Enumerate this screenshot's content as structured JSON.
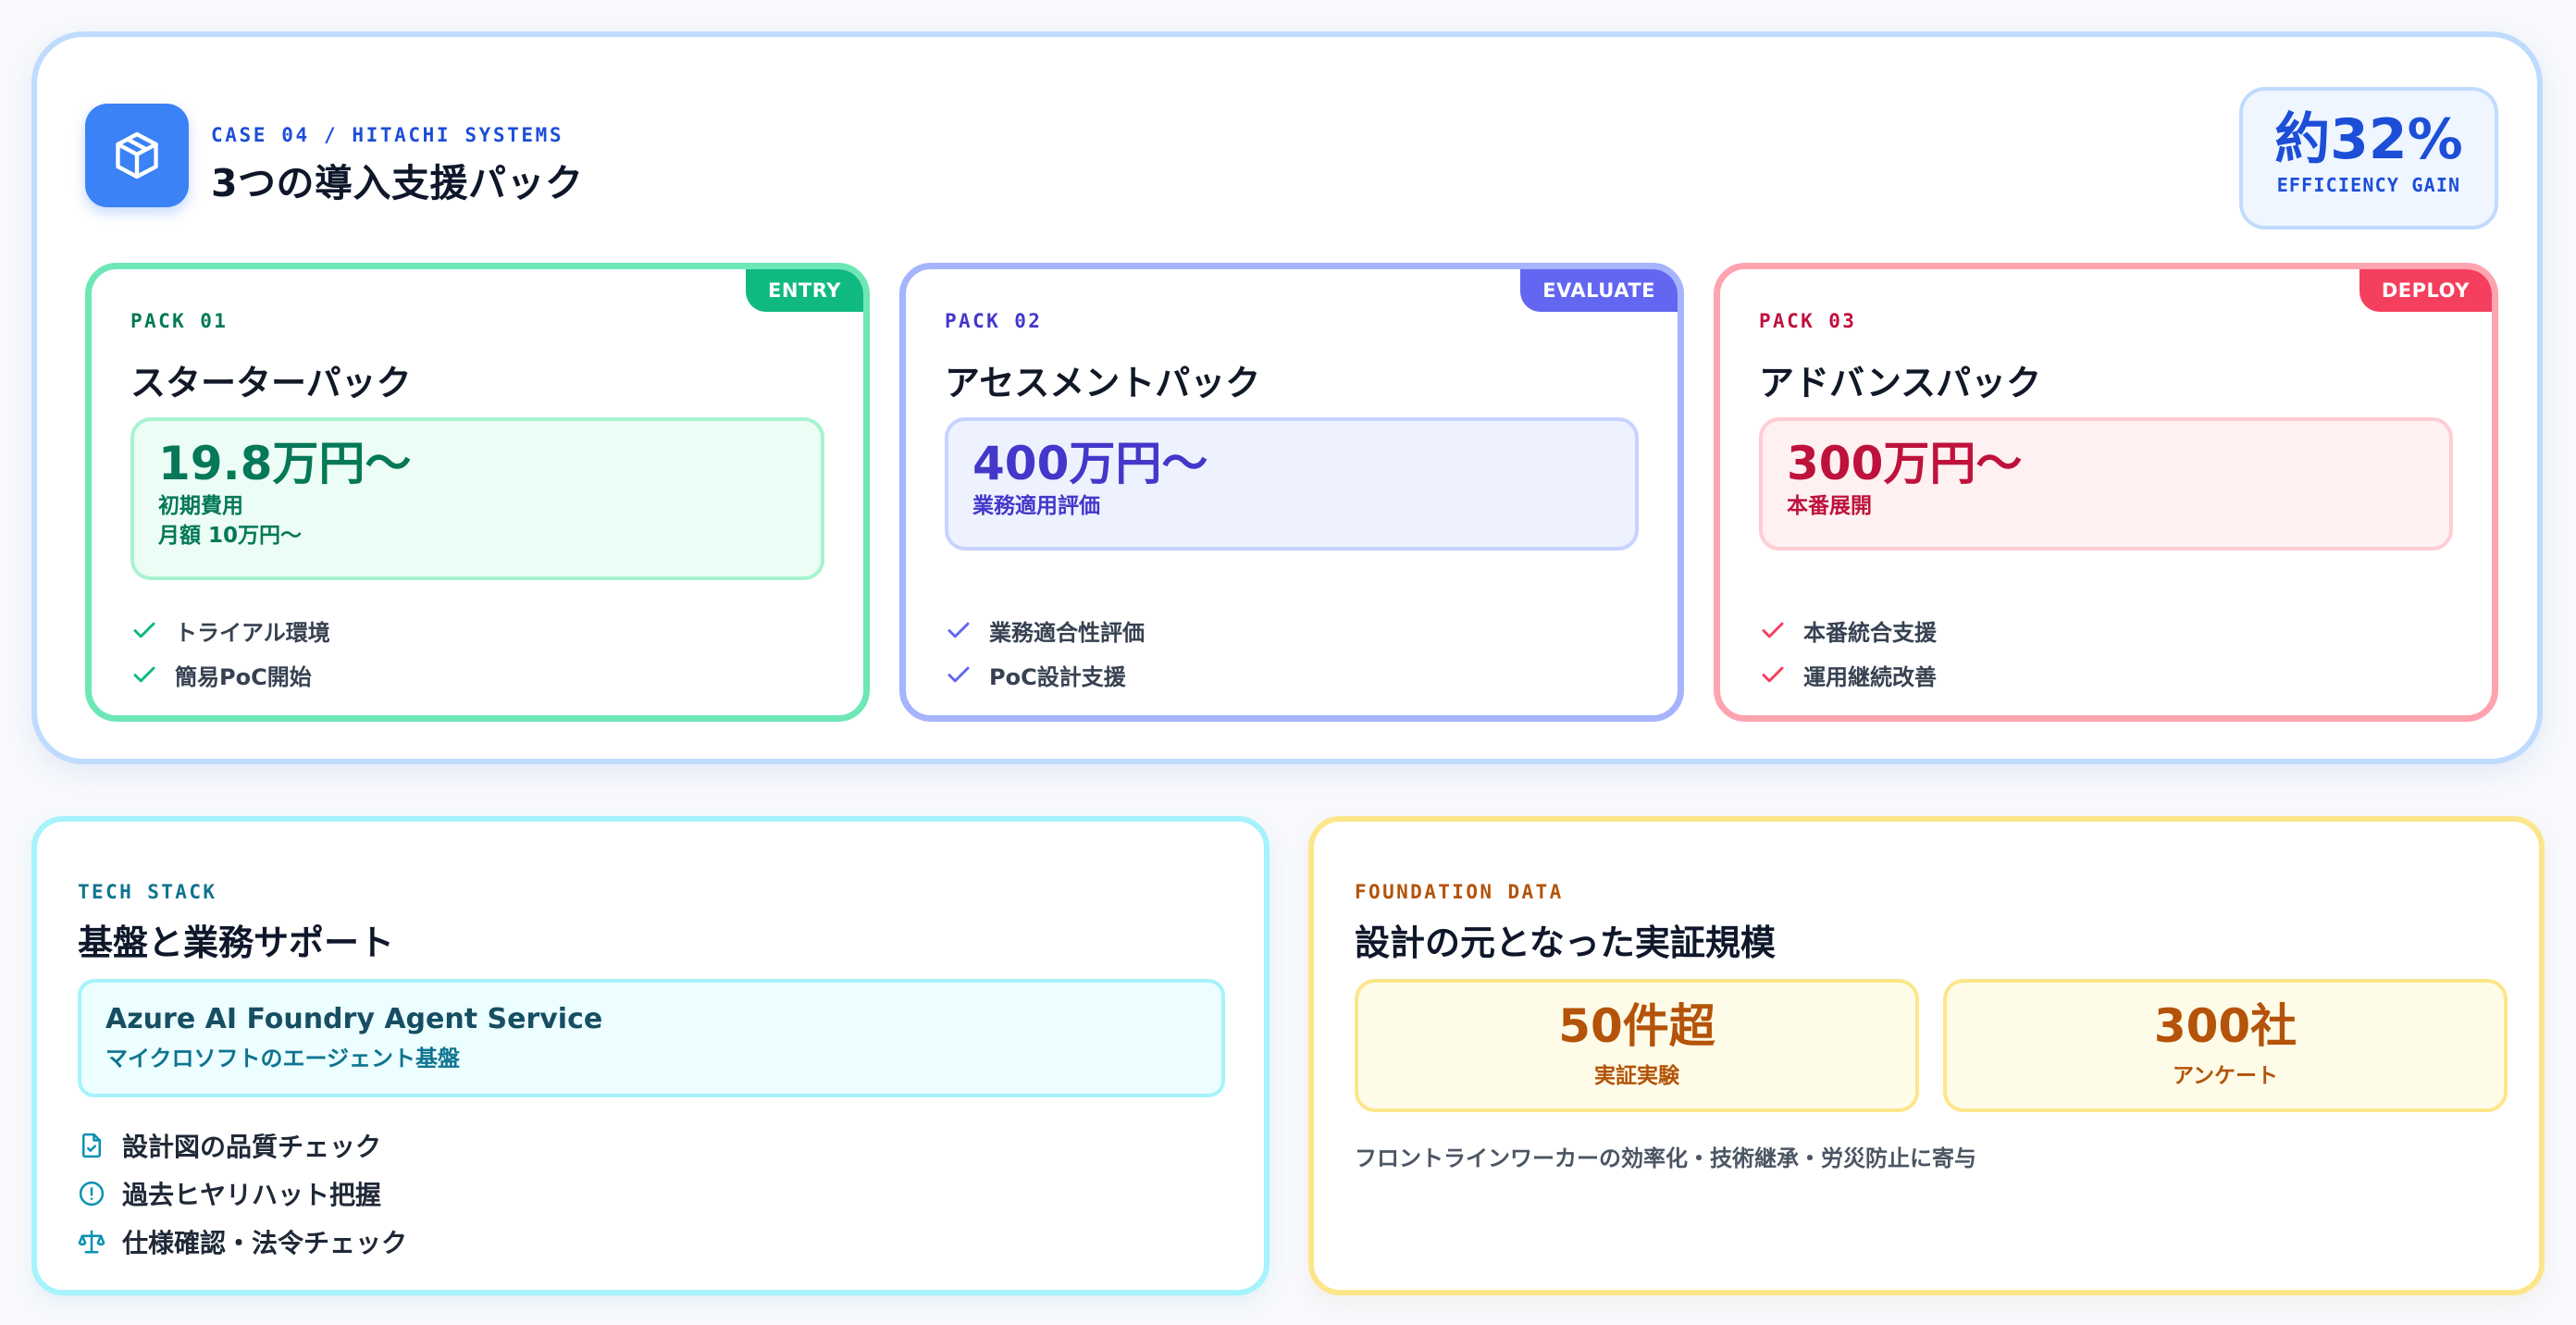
{
  "case": {
    "eyebrow": "CASE 04 / HITACHI SYSTEMS",
    "title": "3つの導入支援パック",
    "icon": "package-icon",
    "gain_value": "約32%",
    "gain_label": "EFFICIENCY GAIN"
  },
  "packs": [
    {
      "badge": "ENTRY",
      "eyebrow": "PACK 01",
      "name": "スターターパック",
      "price": "19.8万円〜",
      "price_sub": [
        "初期費用",
        "月額 10万円〜"
      ],
      "features": [
        "トライアル環境",
        "簡易PoC開始"
      ],
      "color": "#10b981"
    },
    {
      "badge": "EVALUATE",
      "eyebrow": "PACK 02",
      "name": "アセスメントパック",
      "price": "400万円〜",
      "price_sub": [
        "業務適用評価"
      ],
      "features": [
        "業務適合性評価",
        "PoC設計支援"
      ],
      "color": "#6366f1"
    },
    {
      "badge": "DEPLOY",
      "eyebrow": "PACK 03",
      "name": "アドバンスパック",
      "price": "300万円〜",
      "price_sub": [
        "本番展開"
      ],
      "features": [
        "本番統合支援",
        "運用継続改善"
      ],
      "color": "#f43f5e"
    }
  ],
  "tech": {
    "eyebrow": "TECH STACK",
    "title": "基盤と業務サポート",
    "service_name": "Azure AI Foundry Agent Service",
    "service_desc": "マイクロソフトのエージェント基盤",
    "items": [
      {
        "icon": "file-check-icon",
        "label": "設計図の品質チェック"
      },
      {
        "icon": "alert-circle-icon",
        "label": "過去ヒヤリハット把握"
      },
      {
        "icon": "scale-icon",
        "label": "仕様確認・法令チェック"
      }
    ]
  },
  "foundation": {
    "eyebrow": "FOUNDATION DATA",
    "title": "設計の元となった実証規模",
    "stats": [
      {
        "value": "50件超",
        "label": "実証実験"
      },
      {
        "value": "300社",
        "label": "アンケート"
      }
    ],
    "note": "フロントラインワーカーの効率化・技術継承・労災防止に寄与"
  }
}
